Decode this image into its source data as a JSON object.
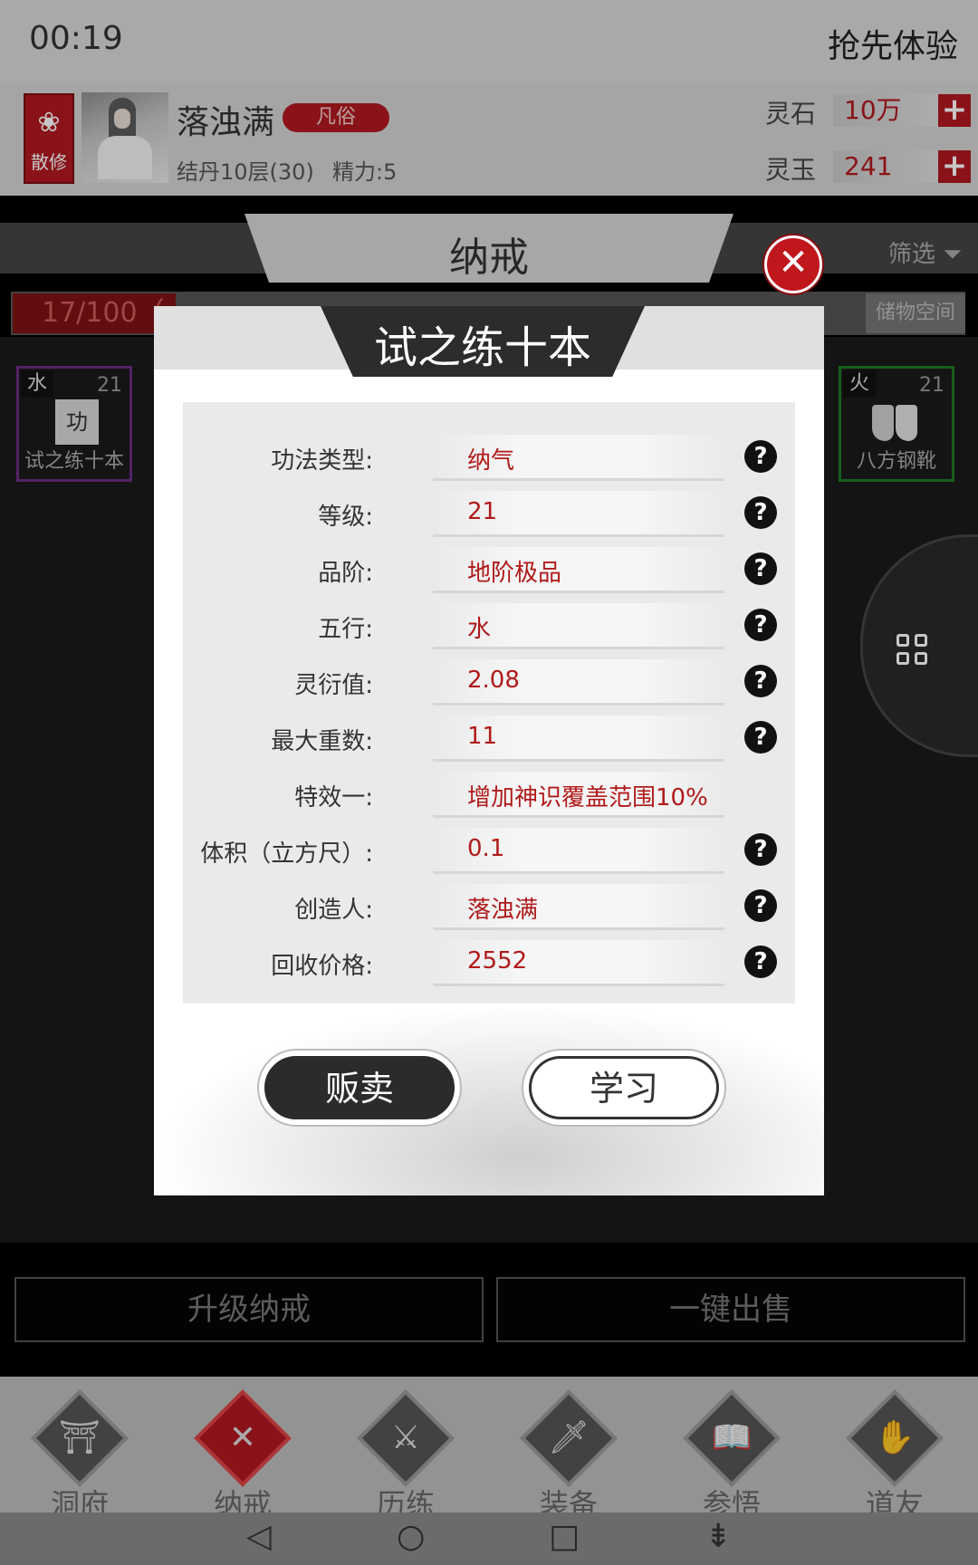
{
  "status": {
    "time": "00:19",
    "early_access": "抢先体验"
  },
  "player": {
    "sect_badge": "散修",
    "name": "落浊满",
    "rank": "凡俗",
    "realm": "结丹10层(30)",
    "energy": "精力:5",
    "currencies": [
      {
        "label": "灵石",
        "value": "10万"
      },
      {
        "label": "灵玉",
        "value": "241"
      }
    ]
  },
  "storage": {
    "title": "纳戒",
    "filter": "筛选",
    "capacity": "17/100（",
    "storage_button": "储物空间",
    "items": [
      {
        "element": "水",
        "level": "21",
        "name": "试之练十本",
        "icon_text": "功"
      },
      {
        "element": "火",
        "level": "21",
        "name": "八方钢靴"
      }
    ],
    "upgrade_button": "升级纳戒",
    "sell_all_button": "一键出售"
  },
  "bottom_nav": [
    {
      "label": "洞府",
      "icon": "cave-icon"
    },
    {
      "label": "纳戒",
      "icon": "ring-icon"
    },
    {
      "label": "历练",
      "icon": "swords-icon"
    },
    {
      "label": "装备",
      "icon": "sword-icon"
    },
    {
      "label": "参悟",
      "icon": "book-icon"
    },
    {
      "label": "道友",
      "icon": "handshake-icon"
    }
  ],
  "dialog": {
    "title": "试之练十本",
    "attributes": [
      {
        "label": "功法类型:",
        "value": "纳气",
        "help": true
      },
      {
        "label": "等级:",
        "value": "21",
        "help": true
      },
      {
        "label": "品阶:",
        "value": "地阶极品",
        "help": true
      },
      {
        "label": "五行:",
        "value": "水",
        "help": true
      },
      {
        "label": "灵衍值:",
        "value": "2.08",
        "help": true
      },
      {
        "label": "最大重数:",
        "value": "11",
        "help": true
      },
      {
        "label": "特效一:",
        "value": "增加神识覆盖范围10%",
        "help": false
      },
      {
        "label": "体积（立方尺）:",
        "value": "0.1",
        "help": true
      },
      {
        "label": "创造人:",
        "value": "落浊满",
        "help": true
      },
      {
        "label": "回收价格:",
        "value": "2552",
        "help": true
      }
    ],
    "sell_button": "贩卖",
    "learn_button": "学习"
  },
  "colors": {
    "accent_red": "#b0191f",
    "value_red": "#b01a1a",
    "dark": "#2b2b2b"
  }
}
